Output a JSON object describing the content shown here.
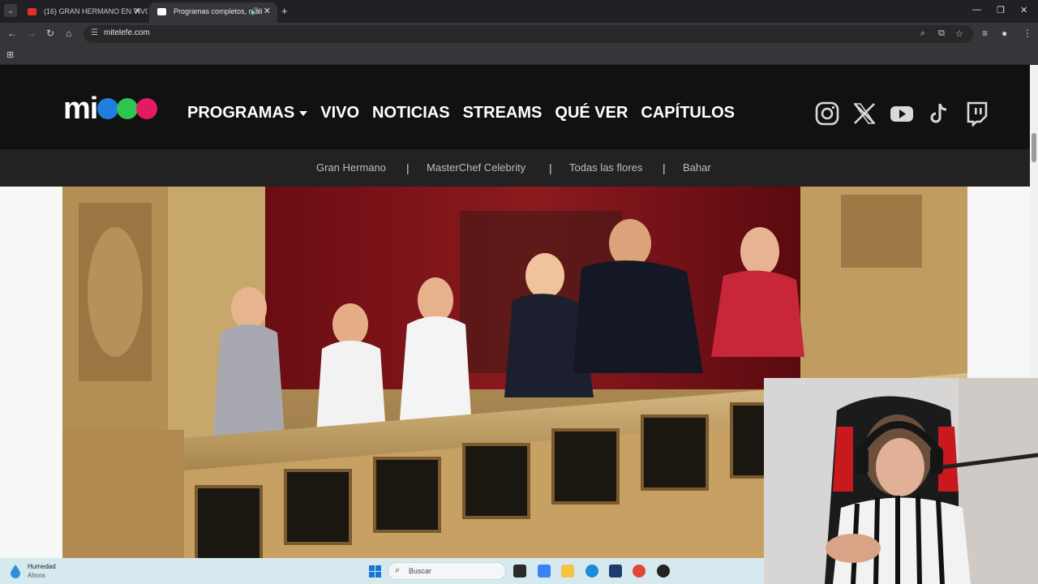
{
  "browser": {
    "tabs": [
      {
        "title": "(16) GRAN HERMANO EN VIVO",
        "active": false
      },
      {
        "title": "Programas completos, reali",
        "active": true
      }
    ],
    "url": "mitelefe.com"
  },
  "site": {
    "logo_text": "mi",
    "logo_dot_colors": [
      "#1e7fe0",
      "#2fc552",
      "#e41a63"
    ],
    "menu": [
      "PROGRAMAS",
      "VIVO",
      "NOTICIAS",
      "STREAMS",
      "QUÉ VER",
      "CAPÍTULOS"
    ],
    "social_icons": [
      "instagram-icon",
      "x-icon",
      "youtube-icon",
      "tiktok-icon",
      "twitch-icon"
    ],
    "subnav": [
      "Gran Hermano",
      "MasterChef Celebrity",
      "Todas las flores",
      "Bahar"
    ],
    "subnav_separator": "|"
  },
  "taskbar": {
    "weather_title": "Humedad",
    "weather_sub": "Ahora",
    "search_placeholder": "Buscar"
  }
}
